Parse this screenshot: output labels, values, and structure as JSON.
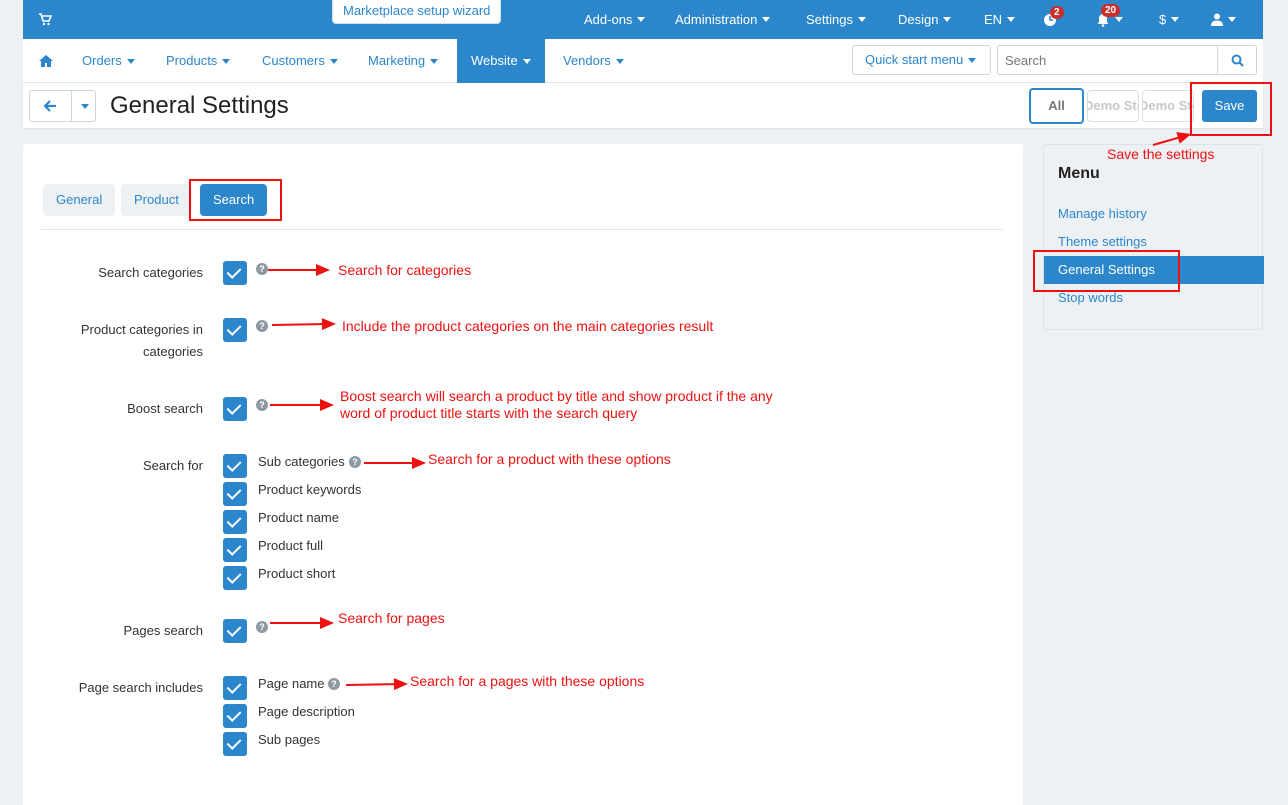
{
  "topbar": {
    "wizard_label": "Marketplace setup wizard",
    "menu": [
      "Add-ons",
      "Administration",
      "Settings",
      "Design",
      "EN"
    ],
    "notifications_badge": "2",
    "bell_badge": "20",
    "currency": "$"
  },
  "nav": {
    "items": [
      "Orders",
      "Products",
      "Customers",
      "Marketing",
      "Website",
      "Vendors"
    ],
    "active": "Website",
    "quick_start": "Quick start menu",
    "search_placeholder": "Search"
  },
  "titlebar": {
    "title": "General Settings",
    "all_label": "All",
    "store1": "Demo Store",
    "store2": "Demo Store",
    "save_label": "Save"
  },
  "tabs": [
    "General",
    "Product",
    "Search"
  ],
  "active_tab": "Search",
  "fields": {
    "search_categories": "Search categories",
    "product_categories": "Product categories in categories",
    "boost_search": "Boost search",
    "search_for": "Search for",
    "search_for_options": [
      "Sub categories",
      "Product keywords",
      "Product name",
      "Product full",
      "Product short"
    ],
    "pages_search": "Pages search",
    "page_search_includes": "Page search includes",
    "page_options": [
      "Page name",
      "Page description",
      "Sub pages"
    ]
  },
  "sidebar": {
    "title": "Menu",
    "items": [
      "Manage history",
      "Theme settings",
      "General Settings",
      "Stop words"
    ],
    "active": "General Settings"
  },
  "annotations": {
    "save": "Save the settings",
    "categories": "Search for categories",
    "product_categories": "Include the product categories on the main categories result",
    "boost": "Boost search will search a product by title and show product if the any word of product title starts with the search query",
    "search_for": "Search for a product with these options",
    "pages": "Search for pages",
    "page_includes": "Search for a pages with these options"
  },
  "colors": {
    "brand": "#2b86cc",
    "annotation": "#ee1111"
  }
}
